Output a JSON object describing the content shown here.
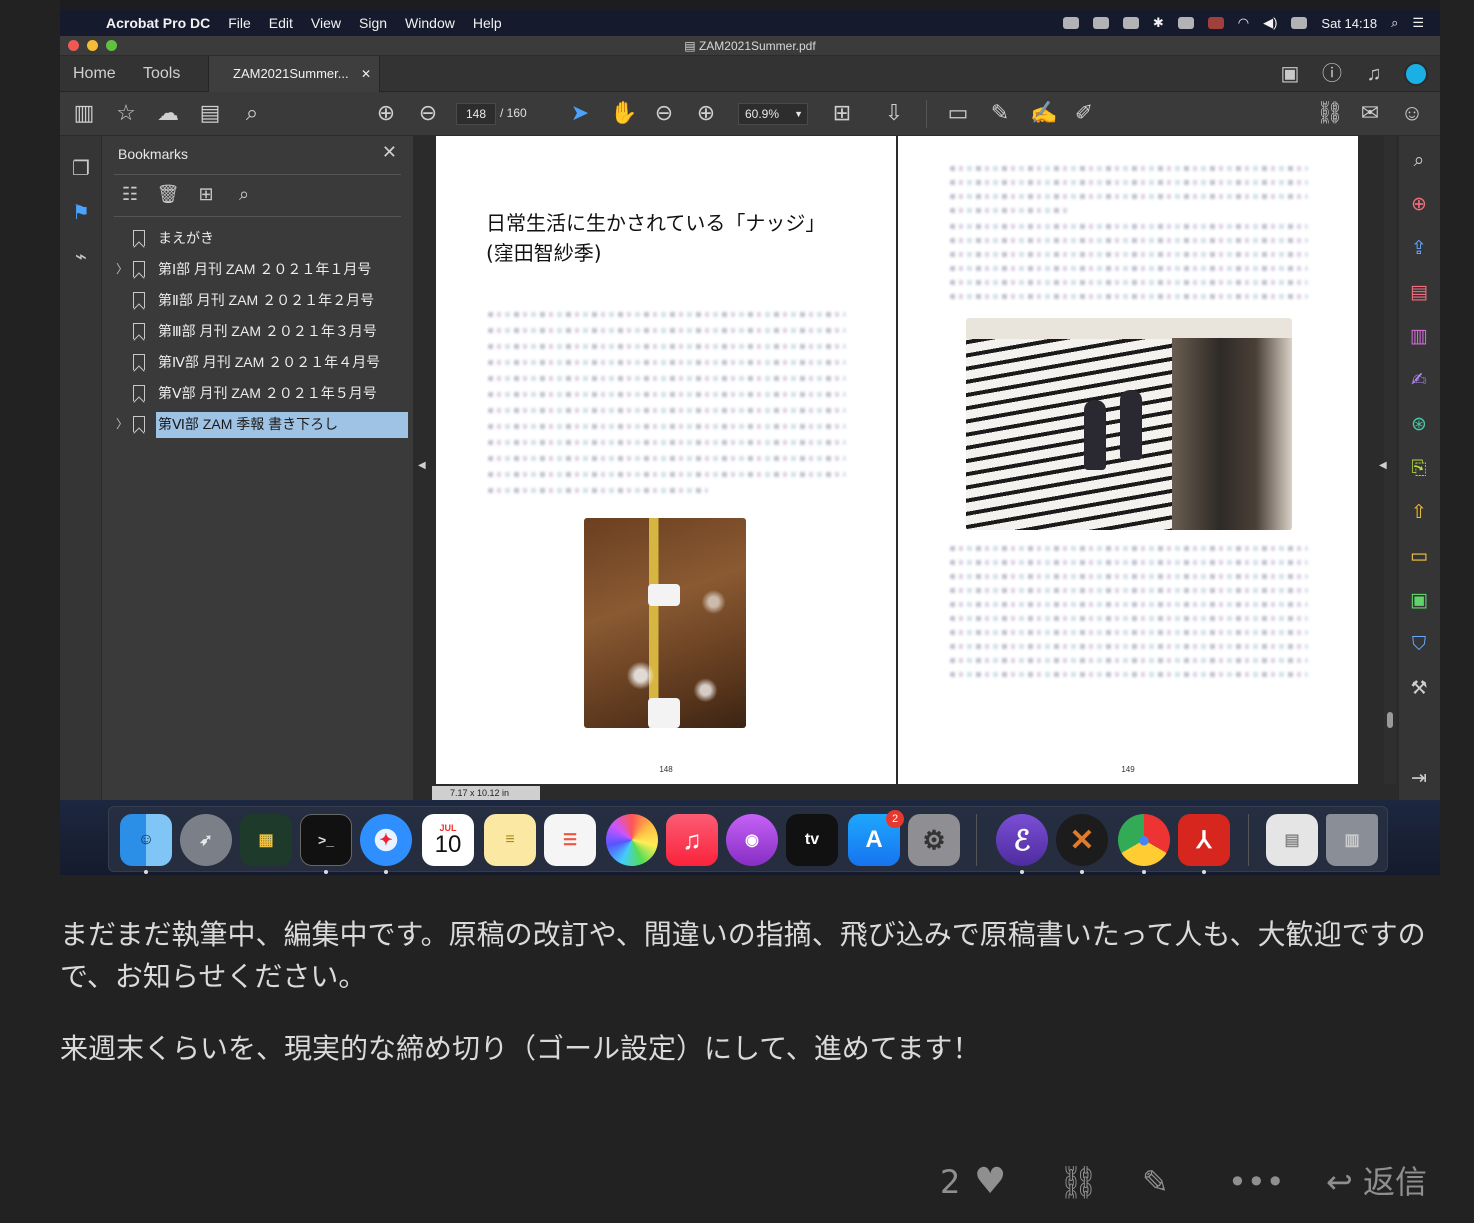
{
  "menubar": {
    "items": [
      "Acrobat Pro DC",
      "File",
      "Edit",
      "View",
      "Sign",
      "Window",
      "Help"
    ],
    "clock": "Sat 14:18"
  },
  "window": {
    "title": "ZAM2021Summer.pdf"
  },
  "tabs": {
    "home": "Home",
    "tools": "Tools",
    "document": "ZAM2021Summer..."
  },
  "toolbar": {
    "current_page": "148",
    "total_pages": "/ 160",
    "zoom": "60.9%"
  },
  "bookmarks": {
    "title": "Bookmarks",
    "items": [
      {
        "label": "まえがき",
        "expandable": false,
        "selected": false
      },
      {
        "label": "第Ⅰ部 月刊 ZAM ２０２１年１月号",
        "expandable": true,
        "selected": false
      },
      {
        "label": "第Ⅱ部 月刊 ZAM ２０２１年２月号",
        "expandable": false,
        "selected": false
      },
      {
        "label": "第Ⅲ部 月刊 ZAM ２０２１年３月号",
        "expandable": false,
        "selected": false
      },
      {
        "label": "第Ⅳ部 月刊 ZAM ２０２１年４月号",
        "expandable": false,
        "selected": false
      },
      {
        "label": "第Ⅴ部 月刊 ZAM ２０２１年５月号",
        "expandable": false,
        "selected": false
      },
      {
        "label": "第Ⅵ部 ZAM 季報 書き下ろし",
        "expandable": true,
        "selected": true
      }
    ]
  },
  "document": {
    "left_page": {
      "title_line1": "日常生活に生かされている「ナッジ」",
      "title_line2": "(窪田智紗季)",
      "page_number": "148"
    },
    "right_page": {
      "page_number": "149"
    },
    "page_size": "7.17 x 10.12 in"
  },
  "dock": {
    "calendar_month": "JUL",
    "calendar_day": "10",
    "appstore_badge": "2",
    "appletv_label": "tv"
  },
  "post": {
    "paragraph1": "まだまだ執筆中、編集中です。原稿の改訂や、間違いの指摘、飛び込みで原稿書いたって人も、大歓迎ですので、お知らせください。",
    "paragraph2": "来週末くらいを、現実的な締め切り（ゴール設定）にして、進めてます！"
  },
  "actions": {
    "like_count": "2",
    "reply_label": "返信"
  },
  "colors": {
    "selection": "#9fc3e4",
    "acrobat_red": "#d7261e",
    "right_tool_purple": "#c77dff"
  }
}
